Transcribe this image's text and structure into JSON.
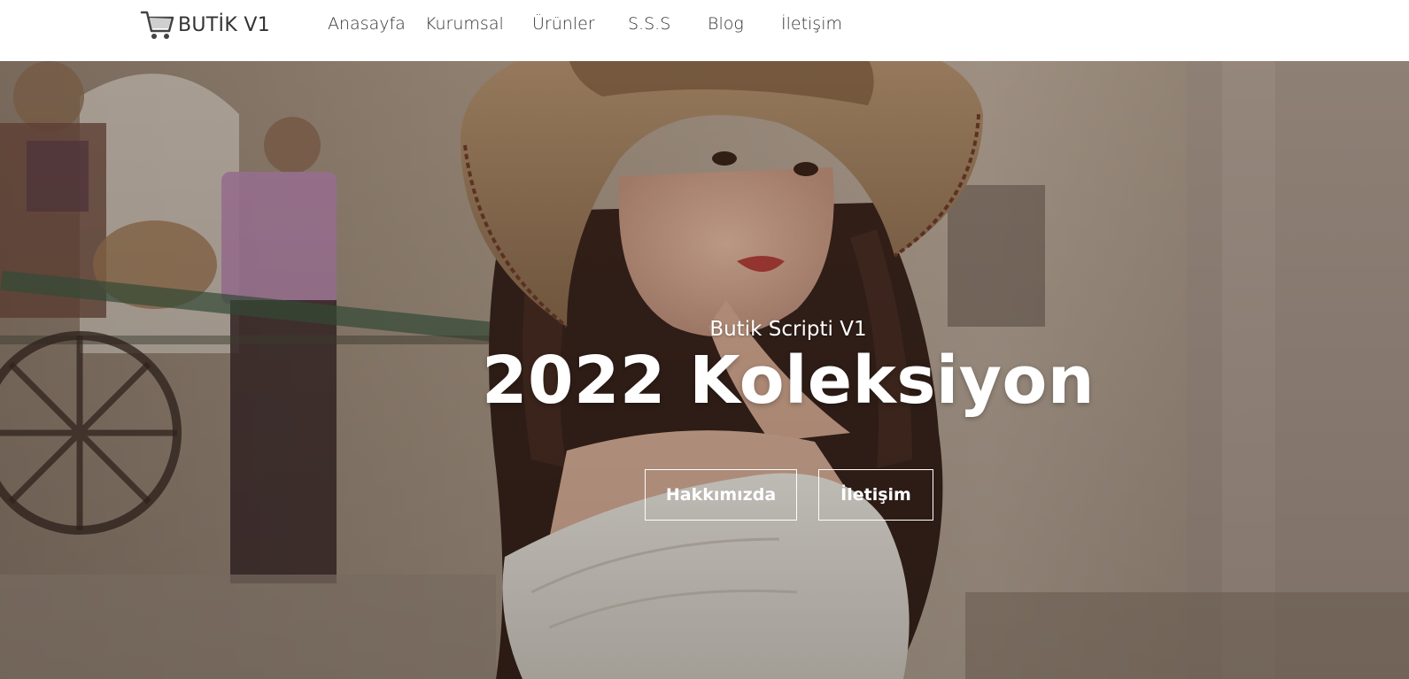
{
  "brand": {
    "name": "BUTİK V1",
    "icon": "shopping-cart-icon"
  },
  "nav": {
    "items": [
      {
        "label": "Anasayfa"
      },
      {
        "label": "Kurumsal"
      },
      {
        "label": "Ürünler"
      },
      {
        "label": "S.S.S"
      },
      {
        "label": "Blog"
      },
      {
        "label": "İletişim"
      }
    ]
  },
  "hero": {
    "subtitle": "Butik Scripti V1",
    "title": "2022 Koleksiyon",
    "buttons": {
      "about": "Hakkımızda",
      "contact": "İletişim"
    }
  },
  "colors": {
    "nav_text": "#333333",
    "hero_text": "#ffffff",
    "nav_bg": "#ffffff"
  }
}
